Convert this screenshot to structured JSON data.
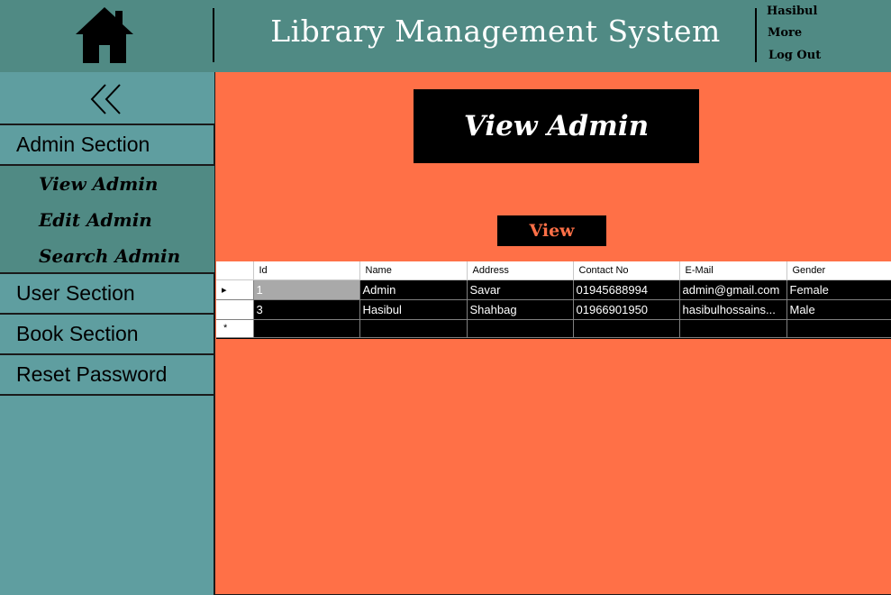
{
  "header": {
    "title": "Library Management System",
    "user_name": "Hasibul",
    "more_label": "More",
    "logout_label": "Log Out"
  },
  "sidebar": {
    "admin_section": "Admin Section",
    "admin_items": [
      "View Admin",
      "Edit Admin",
      "Search Admin"
    ],
    "user_section": "User Section",
    "book_section": "Book Section",
    "reset_password": "Reset Password"
  },
  "main": {
    "page_title": "View Admin",
    "view_button": "View"
  },
  "grid": {
    "columns": [
      "Id",
      "Name",
      "Address",
      "Contact No",
      "E-Mail",
      "Gender"
    ],
    "rows": [
      [
        "1",
        "Admin",
        "Savar",
        "01945688994",
        "admin@gmail.com",
        "Female"
      ],
      [
        "3",
        "Hasibul",
        "Shahbag",
        "01966901950",
        "hasibulhossains...",
        "Male"
      ]
    ],
    "current_row_marker": "▸",
    "new_row_marker": "*"
  },
  "colors": {
    "header_bg": "#508a84",
    "sidebar_bg": "#5f9ea0",
    "main_bg": "#ff7047",
    "title_box_bg": "#000000"
  },
  "icons": {
    "home": "home-icon",
    "collapse": "double-chevron-left-icon"
  }
}
